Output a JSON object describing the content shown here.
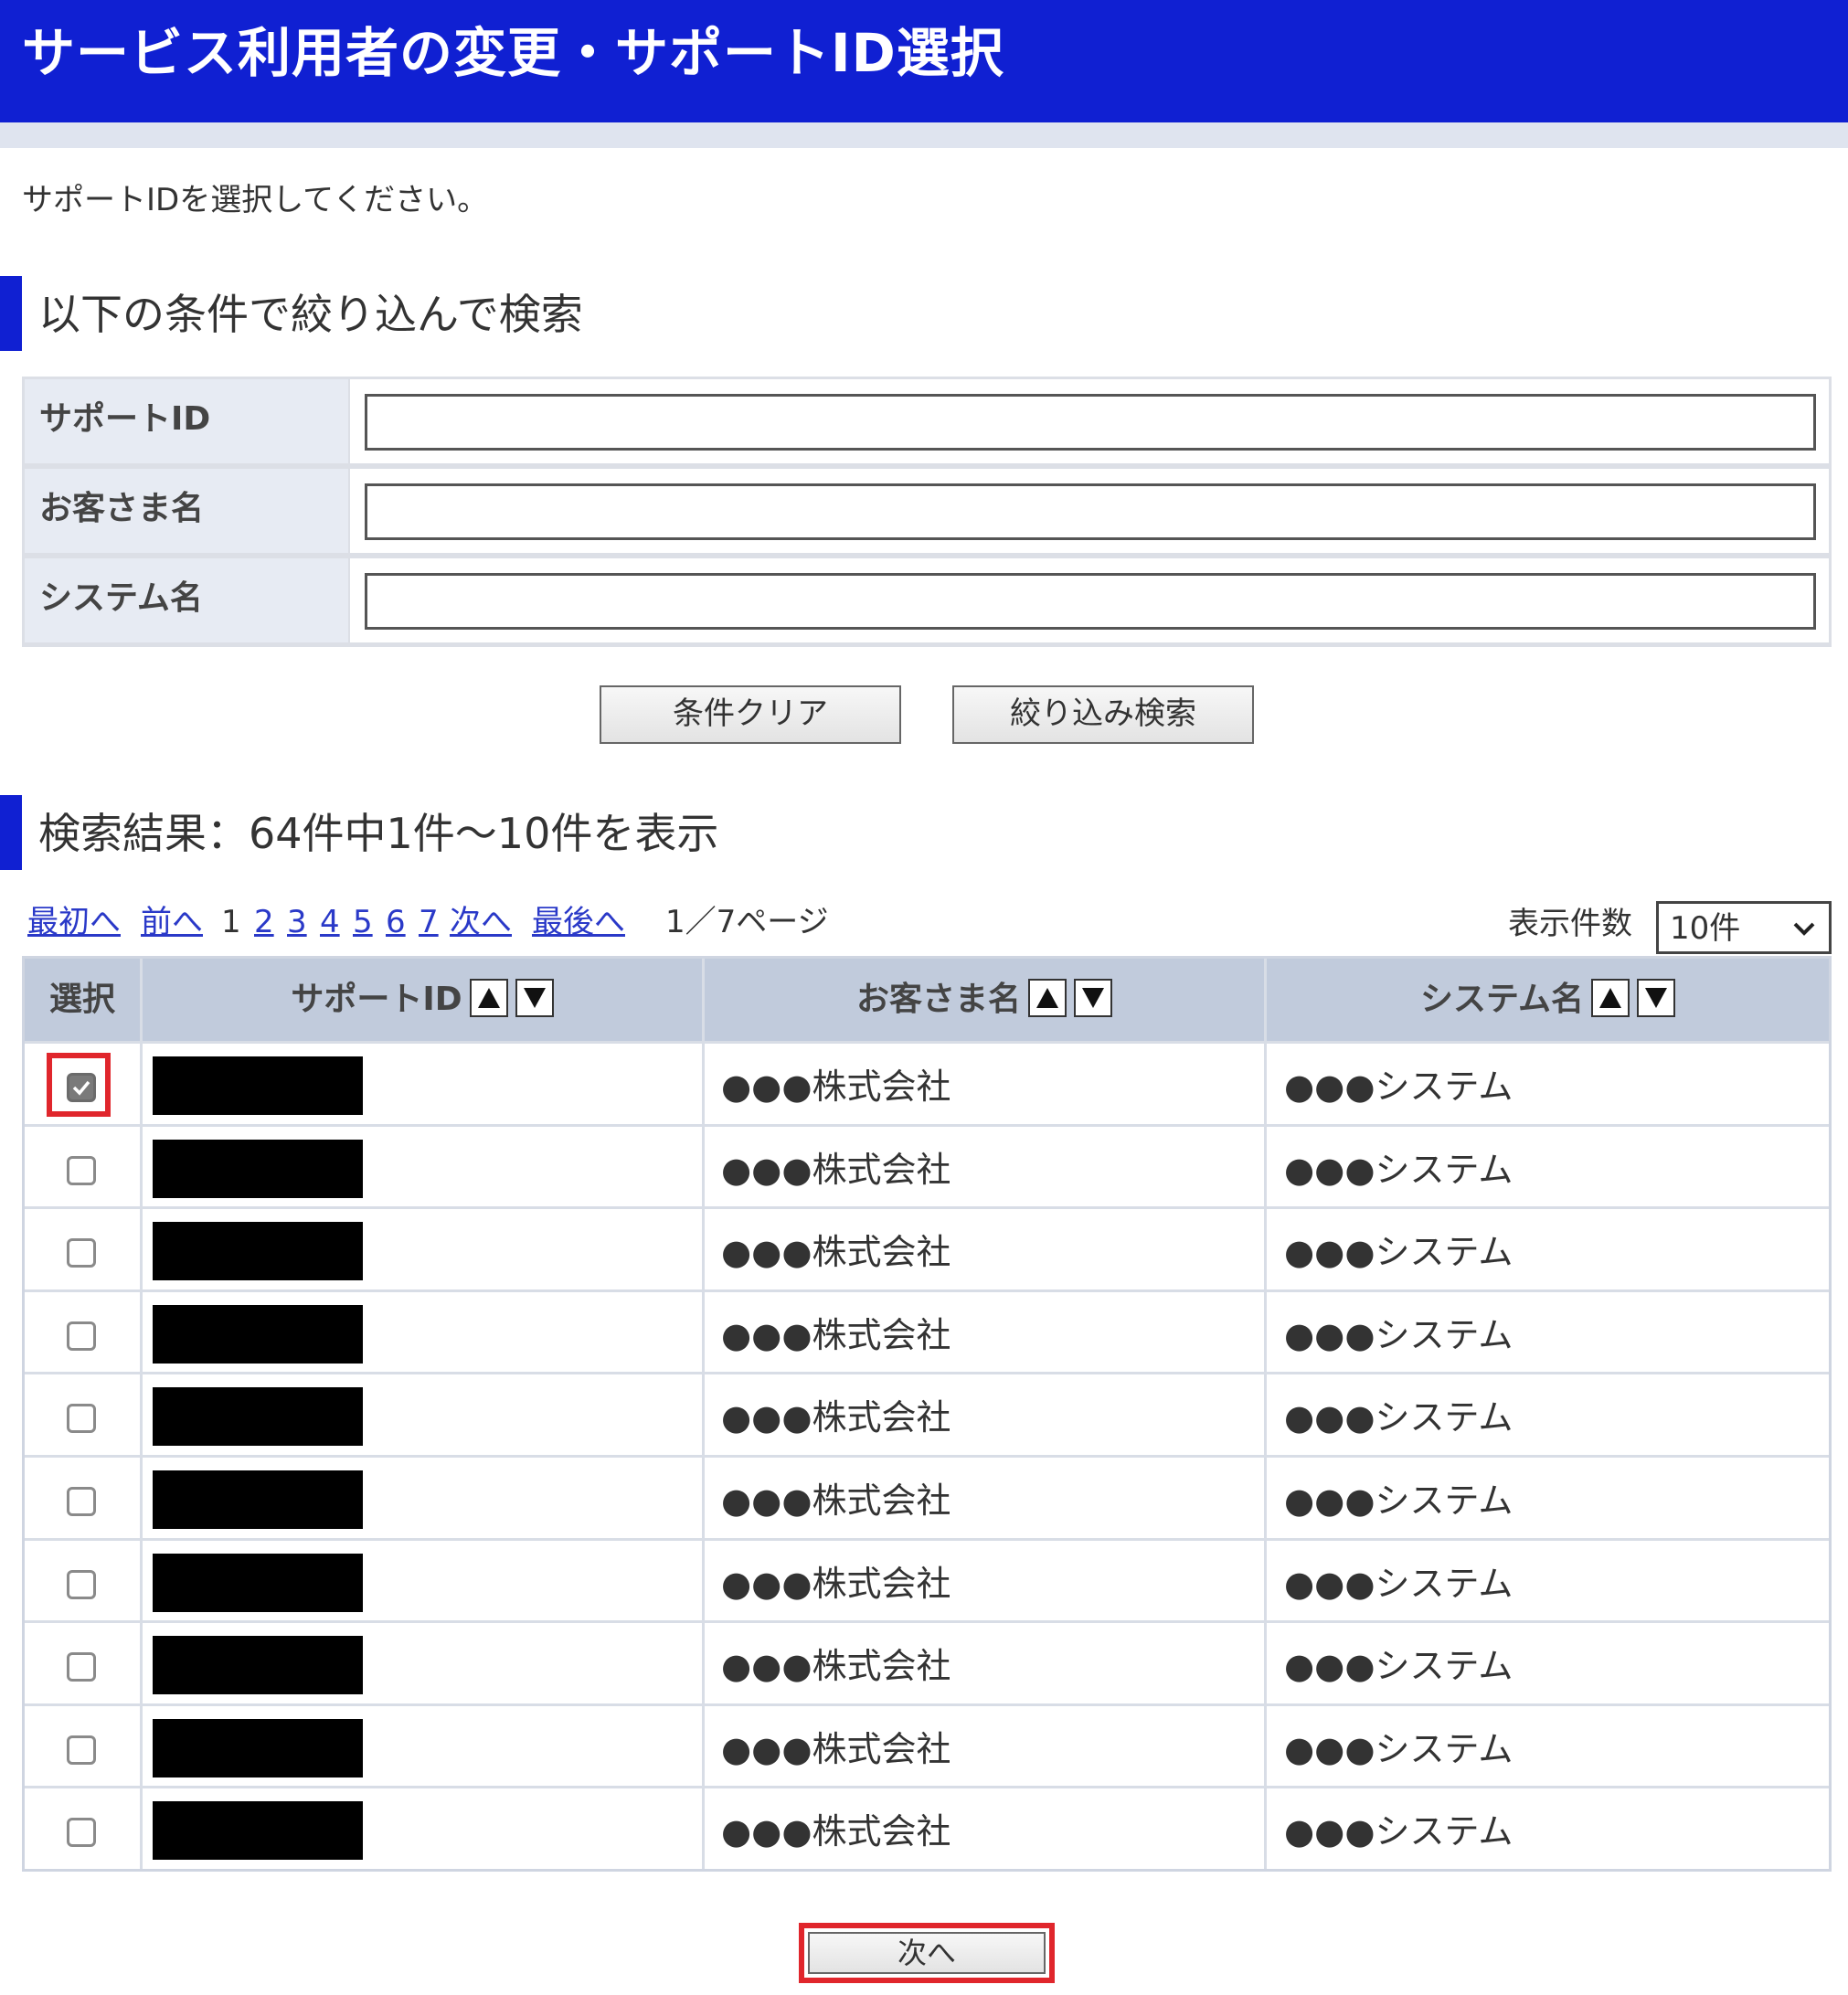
{
  "header": {
    "title": "サービス利用者の変更・サポートID選択"
  },
  "instruction": "サポートIDを選択してください。",
  "filter": {
    "heading": "以下の条件で絞り込んで検索",
    "fields": [
      {
        "label": "サポートID",
        "value": ""
      },
      {
        "label": "お客さま名",
        "value": ""
      },
      {
        "label": "システム名",
        "value": ""
      }
    ],
    "clear_label": "条件クリア",
    "search_label": "絞り込み検索"
  },
  "results": {
    "heading": "検索結果：64件中1件～10件を表示",
    "pager": {
      "first": "最初へ",
      "prev": "前へ",
      "pages": [
        "1",
        "2",
        "3",
        "4",
        "5",
        "6",
        "7"
      ],
      "current_page": "1",
      "next": "次へ",
      "last": "最後へ",
      "page_info": "1／7ページ"
    },
    "per_page": {
      "label": "表示件数",
      "value": "10件"
    },
    "columns": {
      "select": "選択",
      "support_id": "サポートID",
      "customer": "お客さま名",
      "system": "システム名"
    },
    "rows": [
      {
        "checked": true,
        "support_id": "",
        "customer": "●●●株式会社",
        "system": "●●●システム"
      },
      {
        "checked": false,
        "support_id": "",
        "customer": "●●●株式会社",
        "system": "●●●システム"
      },
      {
        "checked": false,
        "support_id": "",
        "customer": "●●●株式会社",
        "system": "●●●システム"
      },
      {
        "checked": false,
        "support_id": "",
        "customer": "●●●株式会社",
        "system": "●●●システム"
      },
      {
        "checked": false,
        "support_id": "",
        "customer": "●●●株式会社",
        "system": "●●●システム"
      },
      {
        "checked": false,
        "support_id": "",
        "customer": "●●●株式会社",
        "system": "●●●システム"
      },
      {
        "checked": false,
        "support_id": "",
        "customer": "●●●株式会社",
        "system": "●●●システム"
      },
      {
        "checked": false,
        "support_id": "",
        "customer": "●●●株式会社",
        "system": "●●●システム"
      },
      {
        "checked": false,
        "support_id": "",
        "customer": "●●●株式会社",
        "system": "●●●システム"
      },
      {
        "checked": false,
        "support_id": "",
        "customer": "●●●株式会社",
        "system": "●●●システム"
      }
    ]
  },
  "next_label": "次へ",
  "colors": {
    "brand": "#1020d2",
    "highlight": "#e0262c",
    "link": "#2a39c8"
  }
}
